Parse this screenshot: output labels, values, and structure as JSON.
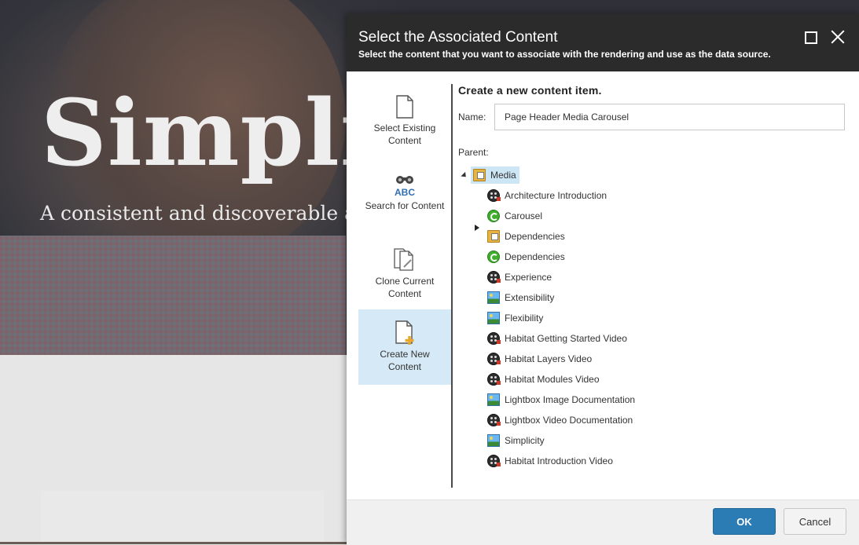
{
  "background": {
    "hero_title": "Simpli",
    "hero_subtitle": "A consistent and discoverable a"
  },
  "dialog": {
    "title": "Select the Associated Content",
    "subtitle": "Select the content that you want to associate with the rendering and use as the data source.",
    "header_buttons": {
      "maximize_icon": "maximize-icon",
      "close_icon": "close-icon"
    },
    "options": [
      {
        "label": "Select Existing Content",
        "icon": "document-icon",
        "selected": false
      },
      {
        "label": "Search for Content",
        "icon": "binoculars-abc-icon",
        "selected": false
      },
      {
        "label": "Clone Current Content",
        "icon": "clone-document-icon",
        "selected": false
      },
      {
        "label": "Create New Content",
        "icon": "new-document-icon",
        "selected": true
      }
    ],
    "panel": {
      "heading": "Create a new content item.",
      "name_label": "Name:",
      "name_value": "Page Header Media Carousel",
      "parent_label": "Parent:"
    },
    "tree": {
      "root": {
        "label": "Media",
        "icon": "media-folder-icon",
        "expanded": true,
        "selected": true
      },
      "children": [
        {
          "label": "Architecture Introduction",
          "icon": "film-icon"
        },
        {
          "label": "Carousel",
          "icon": "carousel-icon"
        },
        {
          "label": "Dependencies",
          "icon": "media-folder-icon",
          "expandable": true
        },
        {
          "label": "Dependencies",
          "icon": "carousel-icon"
        },
        {
          "label": "Experience",
          "icon": "film-icon"
        },
        {
          "label": "Extensibility",
          "icon": "image-icon"
        },
        {
          "label": "Flexibility",
          "icon": "image-icon"
        },
        {
          "label": "Habitat Getting Started Video",
          "icon": "film-icon"
        },
        {
          "label": "Habitat Layers Video",
          "icon": "film-icon"
        },
        {
          "label": "Habitat Modules Video",
          "icon": "film-icon"
        },
        {
          "label": "Lightbox Image Documentation",
          "icon": "image-icon"
        },
        {
          "label": "Lightbox Video Documentation",
          "icon": "film-icon"
        },
        {
          "label": "Simplicity",
          "icon": "image-icon"
        },
        {
          "label": "Habitat Introduction Video",
          "icon": "film-icon"
        }
      ]
    },
    "footer": {
      "ok_label": "OK",
      "cancel_label": "Cancel"
    },
    "colors": {
      "header_bg": "#2b2b2b",
      "selected_option_bg": "#d5e9f6",
      "ok_button": "#2b7bb5"
    }
  }
}
